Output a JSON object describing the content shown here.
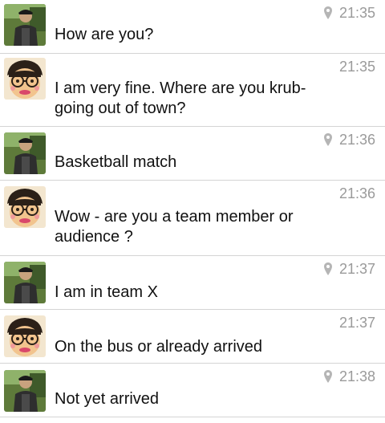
{
  "messages": [
    {
      "sender": "boy",
      "text": "How are you?",
      "time": "21:35",
      "has_location": true,
      "avatar_icon": "photo-avatar-icon"
    },
    {
      "sender": "cartoon",
      "text": "I am very fine. Where are you krub-\ngoing out of town?",
      "time": "21:35",
      "has_location": false,
      "avatar_icon": "cartoon-avatar-icon"
    },
    {
      "sender": "boy",
      "text": "Basketball match",
      "time": "21:36",
      "has_location": true,
      "avatar_icon": "photo-avatar-icon"
    },
    {
      "sender": "cartoon",
      "text": "Wow - are you a team member or\naudience ?",
      "time": "21:36",
      "has_location": false,
      "avatar_icon": "cartoon-avatar-icon"
    },
    {
      "sender": "boy",
      "text": "I am in team X",
      "time": "21:37",
      "has_location": true,
      "avatar_icon": "photo-avatar-icon"
    },
    {
      "sender": "cartoon",
      "text": "On the bus or already arrived",
      "time": "21:37",
      "has_location": false,
      "avatar_icon": "cartoon-avatar-icon"
    },
    {
      "sender": "boy",
      "text": "Not yet arrived",
      "time": "21:38",
      "has_location": true,
      "avatar_icon": "photo-avatar-icon"
    }
  ],
  "colors": {
    "timestamp": "#9a9a9a",
    "divider": "#d4d4d4",
    "text": "#111111"
  }
}
